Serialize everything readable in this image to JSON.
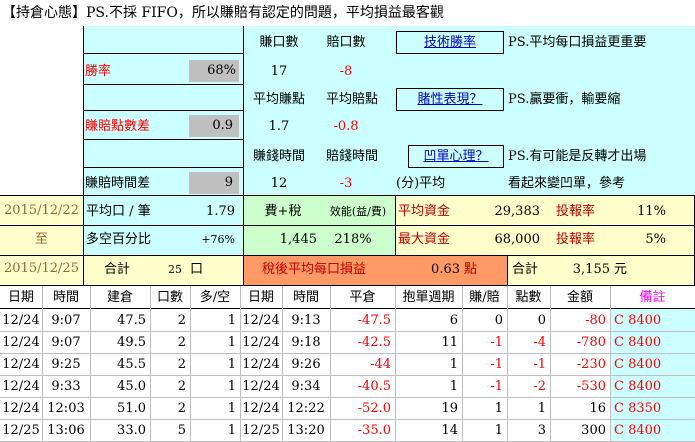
{
  "header": {
    "title": "【持倉心態】PS.不採 FIFO，所以賺賠有認定的問題，平均損益最客觀"
  },
  "stats": {
    "col_win_count": "賺口數",
    "col_loss_count": "賠口數",
    "tech_win_rate_link": "技術勝率",
    "note1": "PS.平均每口損益更重要",
    "win_rate_label": "勝率",
    "win_rate_value": "68%",
    "win_count": "17",
    "loss_count": "-8",
    "col_avg_win": "平均賺點",
    "col_avg_loss": "平均賠點",
    "gamble_link": "賭性表現？",
    "note2": "PS.贏要衝，輸要縮",
    "pl_diff_label": "賺賠點數差",
    "pl_diff_value": "0.9",
    "avg_win": "1.7",
    "avg_loss": "-0.8",
    "col_win_time": "賺錢時間",
    "col_loss_time": "賠錢時間",
    "pit_link": "凹單心理？",
    "note3": "PS.有可能是反轉才出場",
    "time_diff_label": "賺賠時間差",
    "time_diff_value": "9",
    "win_time": "12",
    "loss_time": "-3",
    "avg_minutes": "(分)平均",
    "note4": "看起來變凹單，參考"
  },
  "summary": {
    "date_from": "2015/12/22",
    "to": "至",
    "date_to": "2015/12/25",
    "avg_lot_label": "平均口 / 筆",
    "avg_lot_value": "1.79",
    "fee_tax_label": "費+稅",
    "efficiency_label": "效能(益/費)",
    "avg_capital_label": "平均資金",
    "avg_capital_value": "29,383",
    "return_label1": "投報率",
    "return_value1": "11%",
    "long_short_label": "多空百分比",
    "long_short_value": "+76%",
    "fee_tax_value": "1,445",
    "efficiency_value": "218%",
    "max_capital_label": "最大資金",
    "max_capital_value": "68,000",
    "return_label2": "投報率",
    "return_value2": "5%",
    "total_label": "合計",
    "total_lots": "25",
    "lot_unit": "口",
    "after_tax_label": "稅後平均每口損益",
    "after_tax_value": "0.63",
    "point_unit": "點",
    "total_label2": "合計",
    "total_amount": "3,155",
    "currency_unit": "元"
  },
  "table": {
    "headers": [
      "日期",
      "時間",
      "建倉",
      "口數",
      "多/空",
      "日期",
      "時間",
      "平倉",
      "抱單週期",
      "賺/賠",
      "點數",
      "金額",
      "備註"
    ],
    "rows": [
      [
        "12/24",
        "9:07",
        "47.5",
        "2",
        "1",
        "12/24",
        "9:13",
        "-47.5",
        "6",
        "0",
        "0",
        "-80",
        "C 8400"
      ],
      [
        "12/24",
        "9:07",
        "49.5",
        "2",
        "1",
        "12/24",
        "9:18",
        "-42.5",
        "11",
        "-1",
        "-4",
        "-780",
        "C 8400"
      ],
      [
        "12/24",
        "9:25",
        "45.5",
        "2",
        "1",
        "12/24",
        "9:26",
        "-44",
        "1",
        "-1",
        "-1",
        "-230",
        "C 8400"
      ],
      [
        "12/24",
        "9:33",
        "45.0",
        "2",
        "1",
        "12/24",
        "9:34",
        "-40.5",
        "1",
        "-1",
        "-2",
        "-530",
        "C 8400"
      ],
      [
        "12/24",
        "12:03",
        "51.0",
        "2",
        "1",
        "12/24",
        "12:22",
        "-52.0",
        "19",
        "1",
        "1",
        "16",
        "C 8350"
      ],
      [
        "12/25",
        "13:06",
        "33.0",
        "5",
        "1",
        "12/25",
        "13:20",
        "-35.0",
        "14",
        "1",
        "3",
        "300",
        "C 8400"
      ]
    ]
  }
}
